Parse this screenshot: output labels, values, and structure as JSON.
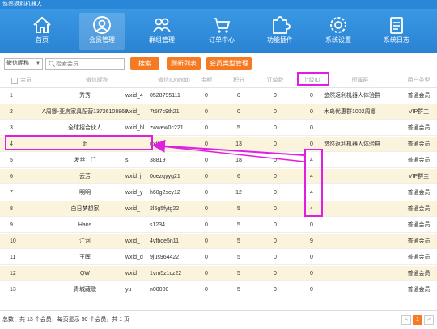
{
  "window": {
    "title": "悠然返利机器人"
  },
  "nav": [
    {
      "label": "首页",
      "icon": "home-icon"
    },
    {
      "label": "会员管理",
      "icon": "user-icon",
      "active": true
    },
    {
      "label": "群组管理",
      "icon": "group-icon"
    },
    {
      "label": "订单中心",
      "icon": "order-icon"
    },
    {
      "label": "功能插件",
      "icon": "puzzle-icon"
    },
    {
      "label": "系统设置",
      "icon": "gear-icon"
    },
    {
      "label": "系统日志",
      "icon": "log-icon"
    }
  ],
  "toolbar": {
    "select_value": "微信昵称",
    "search_placeholder": "检索会员",
    "search_label": "搜索",
    "refresh_label": "刷新列表",
    "type_manage_label": "会员类型管理"
  },
  "table": {
    "headers": [
      "会员",
      "微信昵称",
      "微信ID(wxid)",
      "余额",
      "积分",
      "订单数",
      "上级ID",
      "所属群",
      "用户类型"
    ],
    "rows": [
      {
        "id": "1",
        "nick": "秀秀",
        "wxid": "wxid_4",
        "wxid_tail": "0528795111",
        "balance": "0",
        "points": "0",
        "orders": "0",
        "parent": "0",
        "group": "悠然返利机器人体验群",
        "type": "普通会员"
      },
      {
        "id": "2",
        "nick": "A周娜-亚房家具配营13726108867",
        "wxid": "wxid_",
        "wxid_tail": "7t5t7c9th21",
        "balance": "0",
        "points": "0",
        "orders": "0",
        "parent": "0",
        "group": "木岛优惠群1002周娜",
        "type": "VIP群主"
      },
      {
        "id": "3",
        "nick": "全球招合伙人",
        "wxid": "wxid_hl",
        "wxid_tail": "zwwew0c221",
        "balance": "0",
        "points": "5",
        "orders": "0",
        "parent": "0",
        "group": "",
        "type": "普通会员"
      },
      {
        "id": "4",
        "nick": "th",
        "wxid": "",
        "wxid_tail": "uxth",
        "balance": "0",
        "points": "13",
        "orders": "0",
        "parent": "0",
        "group": "悠然返利机器人体验群",
        "type": "普通会员"
      },
      {
        "id": "5",
        "nick": "发丝　🗋",
        "wxid": "s",
        "wxid_tail": "38819",
        "balance": "0",
        "points": "18",
        "orders": "0",
        "parent": "4",
        "group": "",
        "type": "普通会员"
      },
      {
        "id": "6",
        "nick": "云芳",
        "wxid": "wxid_j",
        "wxid_tail": "0oezqyyg21",
        "balance": "0",
        "points": "6",
        "orders": "0",
        "parent": "4",
        "group": "",
        "type": "VIP群主"
      },
      {
        "id": "7",
        "nick": "明明",
        "wxid": "wxid_y",
        "wxid_tail": "h60g2scy12",
        "balance": "0",
        "points": "12",
        "orders": "0",
        "parent": "4",
        "group": "",
        "type": "普通会员"
      },
      {
        "id": "8",
        "nick": "白日梦想家",
        "wxid": "wxid_",
        "wxid_tail": "2l6g5fytg22",
        "balance": "0",
        "points": "5",
        "orders": "0",
        "parent": "4",
        "group": "",
        "type": "普通会员"
      },
      {
        "id": "9",
        "nick": "Hans",
        "wxid": "",
        "wxid_tail": "s1234",
        "balance": "0",
        "points": "5",
        "orders": "0",
        "parent": "0",
        "group": "",
        "type": "普通会员"
      },
      {
        "id": "10",
        "nick": "江河",
        "wxid": "wxid_",
        "wxid_tail": "4vfboe5n11",
        "balance": "0",
        "points": "5",
        "orders": "0",
        "parent": "9",
        "group": "",
        "type": "普通会员"
      },
      {
        "id": "11",
        "nick": "王晖",
        "wxid": "wxid_d",
        "wxid_tail": "9jus964422",
        "balance": "0",
        "points": "5",
        "orders": "0",
        "parent": "0",
        "group": "",
        "type": "普通会员"
      },
      {
        "id": "12",
        "nick": "QW",
        "wxid": "wxid_",
        "wxid_tail": "1vm5z1cz22",
        "balance": "0",
        "points": "5",
        "orders": "0",
        "parent": "0",
        "group": "",
        "type": "普通会员"
      },
      {
        "id": "13",
        "nick": "青城藏歌",
        "wxid": "yu",
        "wxid_tail": "n00000",
        "balance": "0",
        "points": "5",
        "orders": "0",
        "parent": "0",
        "group": "",
        "type": "普通会员"
      }
    ]
  },
  "footer": {
    "summary": "总数：共 13 个会员，每页显示 50 个会员，共 1 页",
    "prev": "<",
    "page": "1",
    "next": ">"
  },
  "colors": {
    "accent": "#2a86d6",
    "button": "#f57a22",
    "annotation": "#e01ee0",
    "row_alt": "#fbf3dc"
  }
}
